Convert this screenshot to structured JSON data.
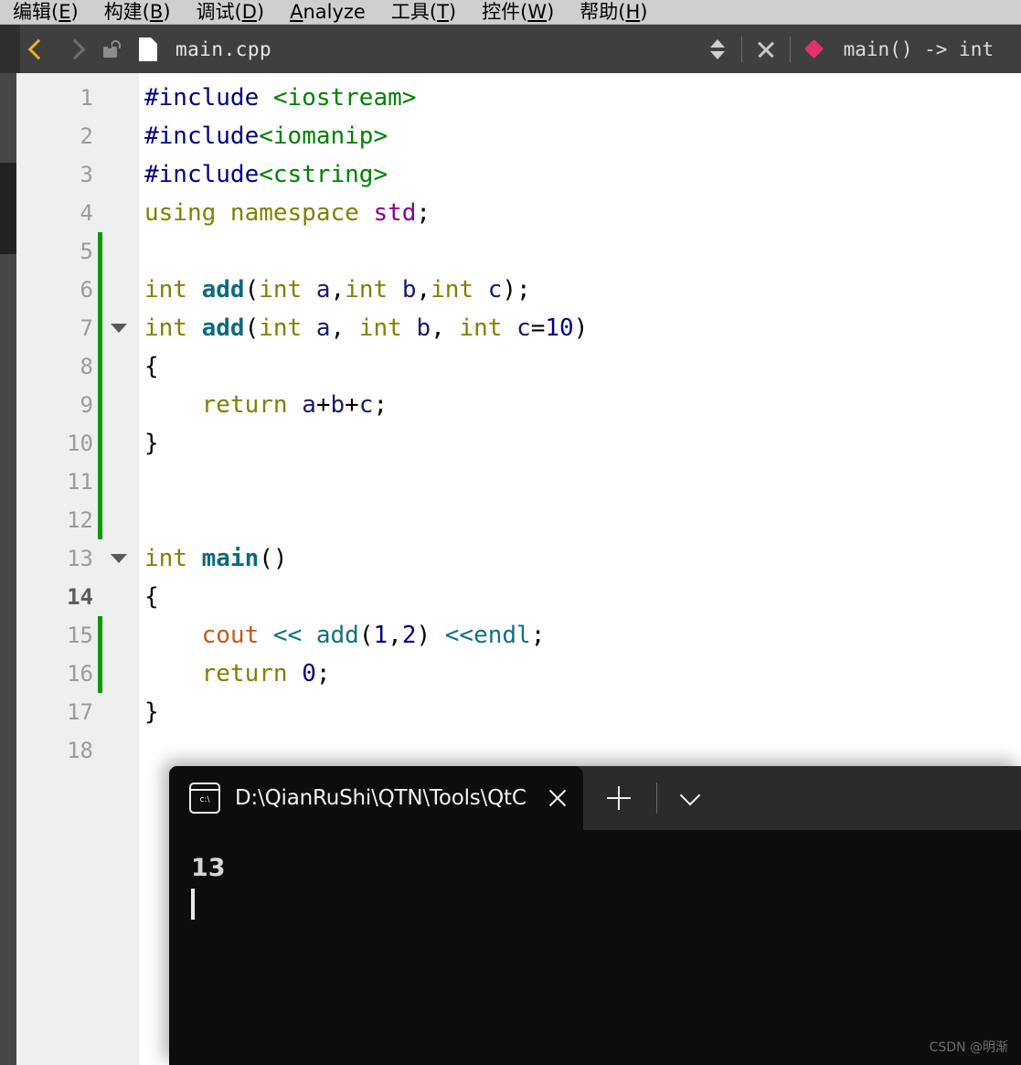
{
  "menubar": {
    "items": [
      {
        "name": "edit",
        "text": "编辑",
        "acc": "E"
      },
      {
        "name": "build",
        "text": "构建",
        "acc": "B"
      },
      {
        "name": "debug",
        "text": "调试",
        "acc": "D"
      },
      {
        "name": "analyze",
        "text": "Analyze",
        "acc": "A",
        "acc_inline": true
      },
      {
        "name": "tools",
        "text": "工具",
        "acc": "T"
      },
      {
        "name": "widgets",
        "text": "控件",
        "acc": "W"
      },
      {
        "name": "help",
        "text": "帮助",
        "acc": "H"
      }
    ]
  },
  "toolbar": {
    "back_icon": "chevron-left-icon",
    "forward_icon": "chevron-right-icon",
    "lock_icon": "unlocked-padlock-icon",
    "file_icon": "document-icon",
    "filename": "main.cpp",
    "updown_icon": "sort-updown-icon",
    "close_icon": "close-icon",
    "symbol_marker_icon": "pink-diamond-icon",
    "symbol_label": "main() -> int"
  },
  "editor": {
    "current_line": 14,
    "lines": [
      {
        "n": 1,
        "changed": false,
        "fold": false,
        "tokens": [
          {
            "t": "#include ",
            "c": "pp"
          },
          {
            "t": "<iostream>",
            "c": "str"
          }
        ]
      },
      {
        "n": 2,
        "changed": false,
        "fold": false,
        "tokens": [
          {
            "t": "#include",
            "c": "pp"
          },
          {
            "t": "<iomanip>",
            "c": "str"
          }
        ]
      },
      {
        "n": 3,
        "changed": false,
        "fold": false,
        "tokens": [
          {
            "t": "#include",
            "c": "pp"
          },
          {
            "t": "<cstring>",
            "c": "str"
          }
        ]
      },
      {
        "n": 4,
        "changed": false,
        "fold": false,
        "tokens": [
          {
            "t": "using namespace ",
            "c": "k"
          },
          {
            "t": "std",
            "c": "ty"
          },
          {
            "t": ";",
            "c": "op"
          }
        ]
      },
      {
        "n": 5,
        "changed": true,
        "fold": false,
        "tokens": []
      },
      {
        "n": 6,
        "changed": true,
        "fold": false,
        "tokens": [
          {
            "t": "int ",
            "c": "k"
          },
          {
            "t": "add",
            "c": "fn"
          },
          {
            "t": "(",
            "c": "op"
          },
          {
            "t": "int ",
            "c": "k"
          },
          {
            "t": "a",
            "c": "var"
          },
          {
            "t": ",",
            "c": "op"
          },
          {
            "t": "int ",
            "c": "k"
          },
          {
            "t": "b",
            "c": "var"
          },
          {
            "t": ",",
            "c": "op"
          },
          {
            "t": "int ",
            "c": "k"
          },
          {
            "t": "c",
            "c": "var"
          },
          {
            "t": ");",
            "c": "op"
          }
        ]
      },
      {
        "n": 7,
        "changed": true,
        "fold": true,
        "tokens": [
          {
            "t": "int ",
            "c": "k"
          },
          {
            "t": "add",
            "c": "fn"
          },
          {
            "t": "(",
            "c": "op"
          },
          {
            "t": "int ",
            "c": "k"
          },
          {
            "t": "a",
            "c": "var"
          },
          {
            "t": ", ",
            "c": "op"
          },
          {
            "t": "int ",
            "c": "k"
          },
          {
            "t": "b",
            "c": "var"
          },
          {
            "t": ", ",
            "c": "op"
          },
          {
            "t": "int ",
            "c": "k"
          },
          {
            "t": "c",
            "c": "var"
          },
          {
            "t": "=",
            "c": "op"
          },
          {
            "t": "10",
            "c": "num"
          },
          {
            "t": ")",
            "c": "op"
          }
        ]
      },
      {
        "n": 8,
        "changed": true,
        "fold": false,
        "tokens": [
          {
            "t": "{",
            "c": "op"
          }
        ]
      },
      {
        "n": 9,
        "changed": true,
        "fold": false,
        "tokens": [
          {
            "t": "    return ",
            "c": "k"
          },
          {
            "t": "a",
            "c": "var"
          },
          {
            "t": "+",
            "c": "op"
          },
          {
            "t": "b",
            "c": "var"
          },
          {
            "t": "+",
            "c": "op"
          },
          {
            "t": "c",
            "c": "var"
          },
          {
            "t": ";",
            "c": "op"
          }
        ]
      },
      {
        "n": 10,
        "changed": true,
        "fold": false,
        "tokens": [
          {
            "t": "}",
            "c": "op"
          }
        ]
      },
      {
        "n": 11,
        "changed": true,
        "fold": false,
        "tokens": []
      },
      {
        "n": 12,
        "changed": true,
        "fold": false,
        "tokens": []
      },
      {
        "n": 13,
        "changed": false,
        "fold": true,
        "tokens": [
          {
            "t": "int ",
            "c": "k"
          },
          {
            "t": "main",
            "c": "fn"
          },
          {
            "t": "()",
            "c": "op"
          }
        ]
      },
      {
        "n": 14,
        "changed": false,
        "fold": false,
        "tokens": [
          {
            "t": "{",
            "c": "op"
          }
        ]
      },
      {
        "n": 15,
        "changed": true,
        "fold": false,
        "tokens": [
          {
            "t": "    ",
            "c": "op"
          },
          {
            "t": "cout",
            "c": "out"
          },
          {
            "t": " ",
            "c": "op"
          },
          {
            "t": "<<",
            "c": "tl"
          },
          {
            "t": " ",
            "c": "op"
          },
          {
            "t": "add",
            "c": "call"
          },
          {
            "t": "(",
            "c": "op"
          },
          {
            "t": "1",
            "c": "num"
          },
          {
            "t": ",",
            "c": "op"
          },
          {
            "t": "2",
            "c": "num"
          },
          {
            "t": ") ",
            "c": "op"
          },
          {
            "t": "<<endl",
            "c": "tl"
          },
          {
            "t": ";",
            "c": "op"
          }
        ]
      },
      {
        "n": 16,
        "changed": true,
        "fold": false,
        "tokens": [
          {
            "t": "    return ",
            "c": "k"
          },
          {
            "t": "0",
            "c": "num"
          },
          {
            "t": ";",
            "c": "op"
          }
        ]
      },
      {
        "n": 17,
        "changed": false,
        "fold": false,
        "tokens": [
          {
            "t": "}",
            "c": "op"
          }
        ]
      },
      {
        "n": 18,
        "changed": false,
        "fold": false,
        "tokens": []
      }
    ]
  },
  "terminal": {
    "tab_icon": "cmd-prompt-icon",
    "tab_icon_text": "c:\\",
    "tab_title": "D:\\QianRuShi\\QTN\\Tools\\QtC",
    "close_icon": "close-icon",
    "new_tab_icon": "plus-icon",
    "dropdown_icon": "chevron-down-icon",
    "output": "13",
    "cursor": "block-cursor"
  },
  "watermark": "CSDN @明渐",
  "colors": {
    "menubar_bg": "#cfcfcf",
    "toolbar_bg": "#3f3f3f",
    "editor_bg": "#ffffff",
    "gutter_bg": "#efefef",
    "change_marker": "#0a9a0a",
    "accent_back_arrow": "#e8b41a",
    "symbol_diamond": "#e0336b",
    "terminal_bg": "#0d0d0d",
    "terminal_titlebar_bg": "#2b2b2b"
  }
}
